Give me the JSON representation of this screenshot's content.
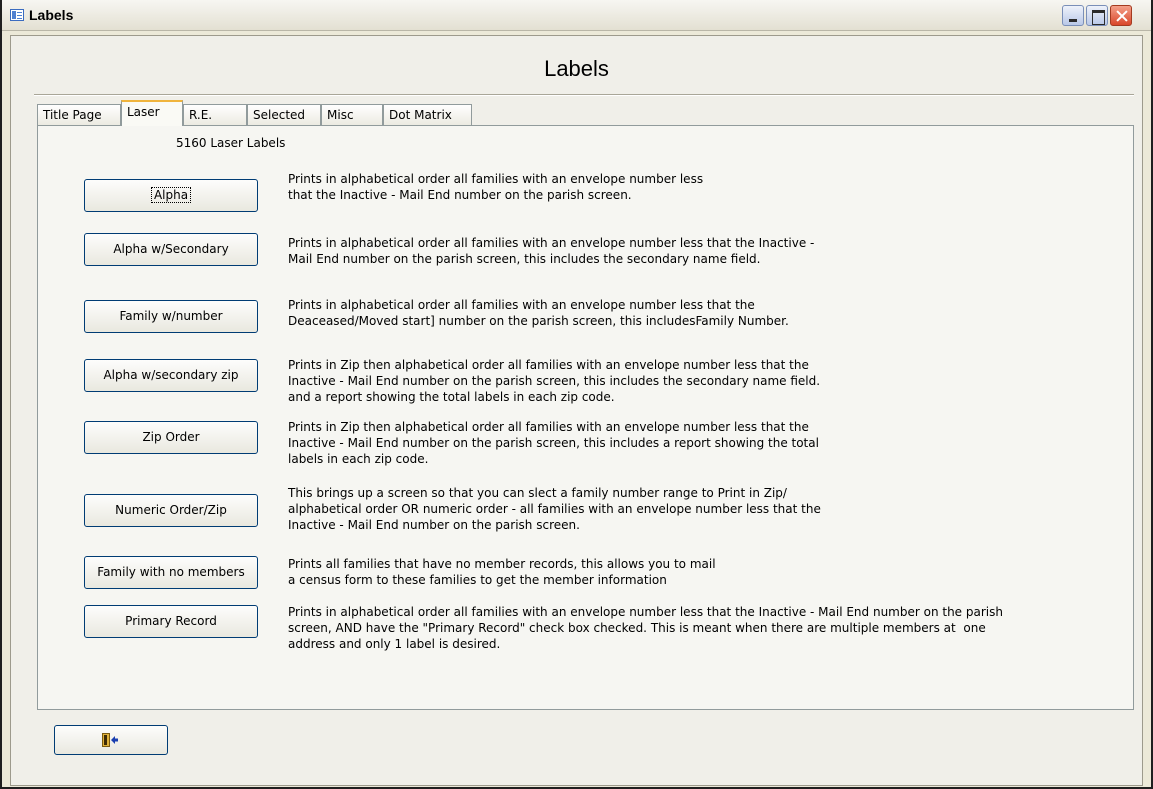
{
  "window": {
    "title": "Labels",
    "minimize_icon": "minimize-icon",
    "maximize_icon": "maximize-icon",
    "close_icon": "close-icon"
  },
  "form": {
    "title": "Labels",
    "tabs": [
      {
        "label": "Title Page",
        "active": false
      },
      {
        "label": "Laser",
        "active": true
      },
      {
        "label": "R.E.",
        "active": false
      },
      {
        "label": "Selected",
        "active": false
      },
      {
        "label": "Misc",
        "active": false
      },
      {
        "label": "Dot Matrix",
        "active": false
      }
    ],
    "subtitle": "5160 Laser Labels",
    "commands": [
      {
        "label": "Alpha",
        "description": "Prints in alphabetical order all families with an envelope number less\nthat the Inactive - Mail End number on the parish screen."
      },
      {
        "label": "Alpha w/Secondary",
        "description": "Prints in alphabetical order all families with an envelope number less that the Inactive -\nMail End number on the parish screen, this includes the secondary name field."
      },
      {
        "label": "Family w/number",
        "description": "Prints in alphabetical order all families with an envelope number less that the\nDeaceased/Moved start] number on the parish screen, this includesFamily Number."
      },
      {
        "label": "Alpha w/secondary zip",
        "description": "Prints in Zip then alphabetical order all families with an envelope number less that the\nInactive - Mail End number on the parish screen, this includes the secondary name field.\nand a report showing the total labels in each zip code."
      },
      {
        "label": "Zip Order",
        "description": "Prints in Zip then alphabetical order all families with an envelope number less that the\nInactive - Mail End number on the parish screen, this includes a report showing the total\nlabels in each zip code."
      },
      {
        "label": "Numeric Order/Zip",
        "description": "This brings up a screen so that you can slect a family number range to Print in Zip/\nalphabetical order OR numeric order - all families with an envelope number less that the\nInactive - Mail End number on the parish screen."
      },
      {
        "label": "Family with no members",
        "description": "Prints all families that have no member records, this allows you to mail\na census form to these families to get the member information"
      },
      {
        "label": "Primary Record",
        "description": "Prints in alphabetical order all families with an envelope number less that the Inactive - Mail End number on the parish\nscreen, AND have the \"Primary Record\" check box checked. This is meant when there are multiple members at  one\naddress and only 1 label is desired."
      }
    ],
    "exit_icon": "exit-door-icon"
  }
}
